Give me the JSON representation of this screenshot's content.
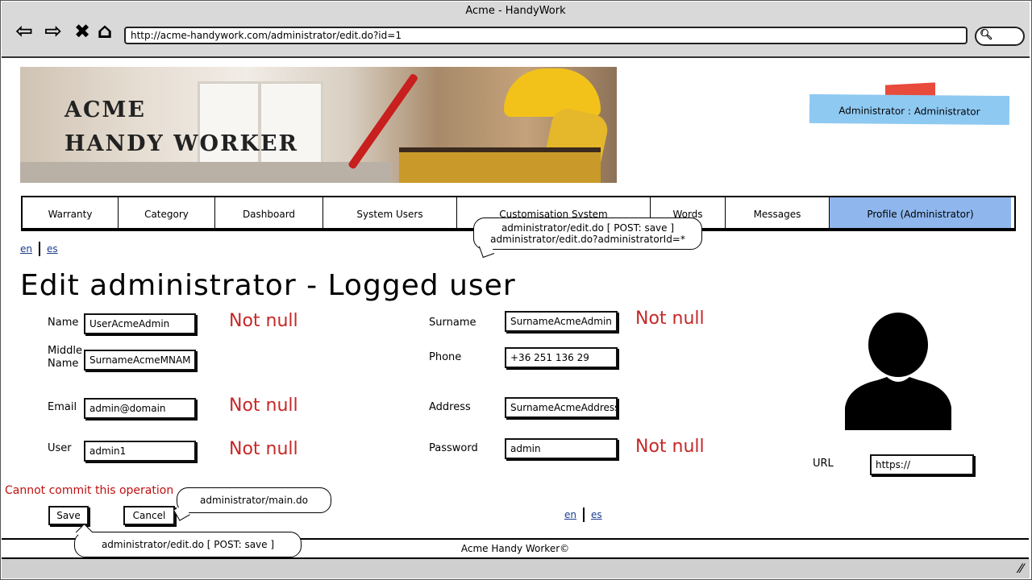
{
  "window": {
    "title": "Acme - HandyWork",
    "url": "http://acme-handywork.com/administrator/edit.do?id=1",
    "icons": [
      "back-arrow-icon",
      "forward-arrow-icon",
      "close-icon",
      "home-icon",
      "search-icon",
      "resize-icon"
    ]
  },
  "banner": {
    "line1": "ACME",
    "line2": "HANDY WORKER"
  },
  "header": {
    "user_badge": "Administrator : Administrator"
  },
  "menu": {
    "items": [
      {
        "label": "Warranty"
      },
      {
        "label": "Category"
      },
      {
        "label": "Dashboard"
      },
      {
        "label": "System Users"
      },
      {
        "label": "Customisation System"
      },
      {
        "label": "Words"
      },
      {
        "label": "Messages"
      },
      {
        "label": "Profile (Administrator)",
        "active": true
      }
    ],
    "active_color": "#8fb7ee"
  },
  "lang_top": {
    "en": "en",
    "es": "es"
  },
  "lang_bottom": {
    "en": "en",
    "es": "es"
  },
  "callouts": {
    "menu_note_line1": "administrator/edit.do [ POST: save ]",
    "menu_note_line2": "administrator/edit.do?administratorId=*",
    "cancel_note": "administrator/main.do",
    "save_note": "administrator/edit.do [ POST: save ]"
  },
  "page": {
    "title": "Edit administrator - Logged user"
  },
  "form": {
    "name_label": "Name",
    "name_value": "UserAcmeAdmin",
    "middle_label_1": "Middle",
    "middle_label_2": "Name",
    "middle_value": "SurnameAcmeMNAM",
    "email_label": "Email",
    "email_value": "admin@domain",
    "user_label": "User",
    "user_value": "admin1",
    "surname_label": "Surname",
    "surname_value": "SurnameAcmeAdmin",
    "phone_label": "Phone",
    "phone_value": "+36 251 136 29",
    "address_label": "Address",
    "address_value": "SurnameAcmeAddress",
    "password_label": "Password",
    "password_value": "admin",
    "url_label": "URL",
    "url_value": "https://",
    "not_null": "Not null",
    "error": "Cannot commit this operation",
    "save_label": "Save",
    "cancel_label": "Cancel",
    "error_color": "#c62828"
  },
  "footer": {
    "text": "Acme Handy Worker©"
  }
}
